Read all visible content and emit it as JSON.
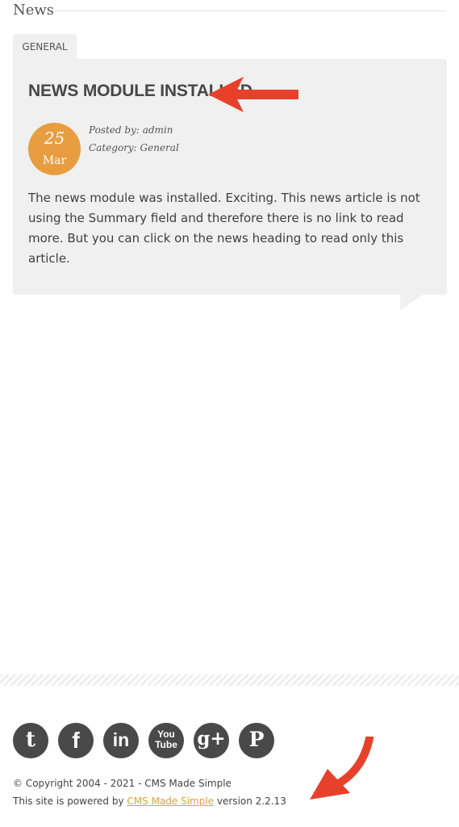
{
  "section": {
    "title": "News"
  },
  "tab": {
    "label": "GENERAL"
  },
  "article": {
    "headline": "NEWS MODULE INSTALLED",
    "date": {
      "day": "25",
      "month": "Mar"
    },
    "posted_by": "Posted by: admin",
    "category": "Category: General",
    "body": "The news module was installed. Exciting. This news article is not using the Summary field and therefore there is no link to read more. But you can click on the news heading to read only this article."
  },
  "social": {
    "twitter_glyph": "t",
    "facebook_glyph": "f",
    "linkedin_glyph": "in",
    "youtube_glyph_top": "You",
    "youtube_glyph_bottom": "Tube",
    "googleplus_glyph": "g+",
    "pinterest_glyph": "P"
  },
  "footer": {
    "copyright": "© Copyright 2004 - 2021 - CMS Made Simple",
    "powered_prefix": "This site is powered by ",
    "powered_link": "CMS Made Simple",
    "powered_suffix": " version 2.2.13"
  },
  "colors": {
    "accent": "#e89e40",
    "annotation_arrow": "#e8412b",
    "card_background": "#f0f0f0",
    "icon_background": "#494949"
  },
  "icons": [
    "twitter-icon",
    "facebook-icon",
    "linkedin-icon",
    "youtube-icon",
    "google-plus-icon",
    "pinterest-icon",
    "arrow-left-icon",
    "arrow-down-left-icon"
  ]
}
